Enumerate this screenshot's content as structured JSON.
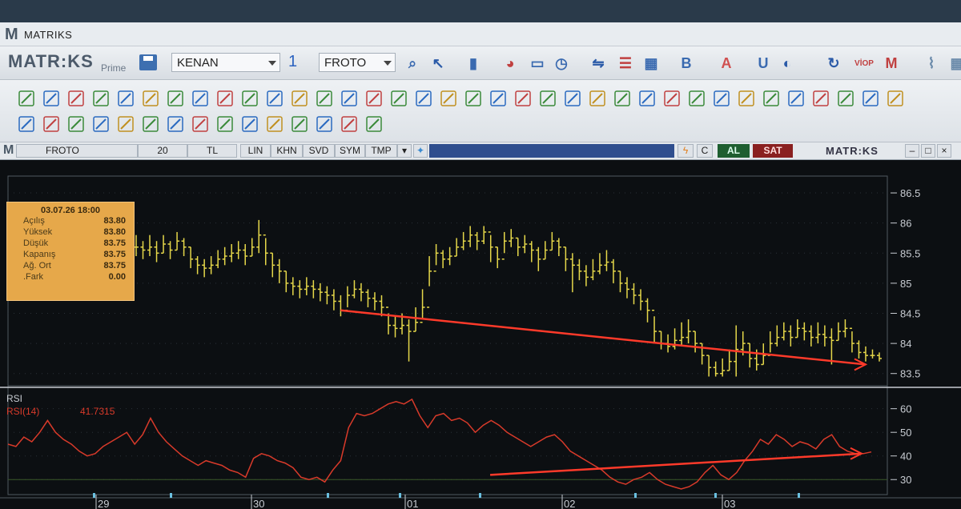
{
  "window": {
    "title": "MATRIKS"
  },
  "toolbar": {
    "brand": "MATR:KS",
    "brand_sub": "Prime",
    "user_select": "KENAN",
    "layout_select": "1",
    "symbol_select": "FROTO"
  },
  "chart_header": {
    "symbol": "FROTO",
    "period": "20",
    "currency": "TL",
    "buttons": [
      "LIN",
      "KHN",
      "SVD",
      "SYM",
      "TMP"
    ],
    "buy_label": "AL",
    "sell_label": "SAT",
    "brand": "MATR:KS"
  },
  "info_box": {
    "date": "03.07.26 18:00",
    "rows": [
      {
        "label": "Açılış",
        "value": "83.80"
      },
      {
        "label": "Yüksek",
        "value": "83.80"
      },
      {
        "label": "Düşük",
        "value": "83.75"
      },
      {
        "label": "Kapanış",
        "value": "83.75"
      },
      {
        "label": "Ağ. Ort",
        "value": "83.75"
      },
      {
        "label": ".Fark",
        "value": "0.00"
      }
    ]
  },
  "colors": {
    "price": "#e6d84a",
    "rsi": "#d83a2a",
    "trendline": "#ff3a2a",
    "grid": "#2a3038",
    "axis_text": "#c8ccd2"
  },
  "chart_data": [
    {
      "type": "ohlc",
      "y_ticks": [
        86.5,
        86,
        85.5,
        85,
        84.5,
        84,
        83.5
      ],
      "ylim": [
        83.35,
        86.7
      ],
      "x_labels": [
        "29",
        "30",
        "01",
        "02",
        "03"
      ],
      "close": [
        85.6,
        85.55,
        85.6,
        85.5,
        85.65,
        85.55,
        85.7,
        85.6,
        85.4,
        85.3,
        85.25,
        85.3,
        85.4,
        85.45,
        85.5,
        85.55,
        85.45,
        85.6,
        85.8,
        85.5,
        85.3,
        85.2,
        85.0,
        84.95,
        84.9,
        84.95,
        84.9,
        84.85,
        84.8,
        84.7,
        84.55,
        84.8,
        84.9,
        84.85,
        84.75,
        84.7,
        84.6,
        84.3,
        84.25,
        84.3,
        84.2,
        84.35,
        84.6,
        85.2,
        85.5,
        85.4,
        85.45,
        85.6,
        85.7,
        85.8,
        85.7,
        85.85,
        85.6,
        85.4,
        85.7,
        85.75,
        85.6,
        85.65,
        85.55,
        85.4,
        85.55,
        85.7,
        85.6,
        85.4,
        85.3,
        85.2,
        85.1,
        85.2,
        85.3,
        85.35,
        85.2,
        85.0,
        84.9,
        84.8,
        84.7,
        84.55,
        84.2,
        84.0,
        83.95,
        84.05,
        84.1,
        84.2,
        84.0,
        83.8,
        83.6,
        83.5,
        83.55,
        83.7,
        83.9,
        84.0,
        83.75,
        83.65,
        83.8,
        84.0,
        84.1,
        84.2,
        84.1,
        84.25,
        84.2,
        84.1,
        84.15,
        84.1,
        84.05,
        84.2,
        84.25,
        84.0,
        83.85,
        83.8,
        83.8,
        83.75
      ],
      "high": [
        85.8,
        85.7,
        85.8,
        85.7,
        85.8,
        85.7,
        85.85,
        85.75,
        85.6,
        85.45,
        85.4,
        85.45,
        85.55,
        85.6,
        85.65,
        85.7,
        85.65,
        85.75,
        86.05,
        85.75,
        85.5,
        85.4,
        85.2,
        85.1,
        85.05,
        85.1,
        85.05,
        85.0,
        84.95,
        84.9,
        84.8,
        84.95,
        85.05,
        85.0,
        84.9,
        84.85,
        84.8,
        84.5,
        84.45,
        84.5,
        84.4,
        84.6,
        84.9,
        85.45,
        85.65,
        85.55,
        85.6,
        85.75,
        85.85,
        85.95,
        85.85,
        85.95,
        85.8,
        85.6,
        85.85,
        85.9,
        85.75,
        85.8,
        85.7,
        85.6,
        85.7,
        85.85,
        85.75,
        85.6,
        85.5,
        85.4,
        85.3,
        85.4,
        85.5,
        85.55,
        85.4,
        85.2,
        85.1,
        85.0,
        84.9,
        84.75,
        84.45,
        84.2,
        84.15,
        84.25,
        84.35,
        84.4,
        84.2,
        84.0,
        83.8,
        83.7,
        83.75,
        83.9,
        84.3,
        84.2,
        84.0,
        83.9,
        84.0,
        84.2,
        84.3,
        84.35,
        84.3,
        84.4,
        84.35,
        84.3,
        84.35,
        84.3,
        84.25,
        84.35,
        84.4,
        84.2,
        84.05,
        83.95,
        83.9,
        83.85
      ],
      "low": [
        85.45,
        85.4,
        85.45,
        85.35,
        85.5,
        85.4,
        85.55,
        85.45,
        85.25,
        85.15,
        85.1,
        85.15,
        85.25,
        85.3,
        85.35,
        85.4,
        85.3,
        85.45,
        85.5,
        85.3,
        85.1,
        85.0,
        84.85,
        84.8,
        84.75,
        84.8,
        84.75,
        84.7,
        84.65,
        84.55,
        84.45,
        84.6,
        84.75,
        84.7,
        84.6,
        84.55,
        84.45,
        84.15,
        84.1,
        84.15,
        83.7,
        84.2,
        84.4,
        84.95,
        85.3,
        85.25,
        85.3,
        85.45,
        85.55,
        85.6,
        85.55,
        85.65,
        85.35,
        85.25,
        85.5,
        85.6,
        85.45,
        85.5,
        85.35,
        85.2,
        85.4,
        85.55,
        85.45,
        85.2,
        84.85,
        85.05,
        84.95,
        85.05,
        85.15,
        85.2,
        85.0,
        84.85,
        84.75,
        84.65,
        84.55,
        84.35,
        84.0,
        83.9,
        83.85,
        83.9,
        83.95,
        84.0,
        83.85,
        83.65,
        83.45,
        83.45,
        83.45,
        83.55,
        83.45,
        83.8,
        83.6,
        83.55,
        83.65,
        83.85,
        83.95,
        84.05,
        83.95,
        84.1,
        84.05,
        83.95,
        84.0,
        83.95,
        83.65,
        84.05,
        84.1,
        83.85,
        83.75,
        83.7,
        83.75,
        83.7
      ],
      "trendline": {
        "from": [
          30,
          84.55
        ],
        "to": [
          107,
          83.65
        ]
      }
    },
    {
      "type": "line",
      "title": "RSI",
      "series": [
        {
          "name": "RSI(14)",
          "last_value": "41.7315"
        }
      ],
      "y_ticks": [
        60,
        50,
        40,
        30
      ],
      "ylim": [
        25,
        67
      ],
      "values": [
        45,
        44,
        48,
        46,
        50,
        55,
        50,
        47,
        45,
        42,
        40,
        41,
        44,
        46,
        48,
        50,
        45,
        49,
        56,
        50,
        46,
        43,
        40,
        38,
        36,
        38,
        37,
        36,
        34,
        33,
        31,
        39,
        41,
        40,
        38,
        37,
        35,
        31,
        30,
        31,
        29,
        34,
        38,
        52,
        58,
        57,
        58,
        60,
        62,
        63,
        62,
        64,
        57,
        52,
        57,
        58,
        55,
        56,
        54,
        50,
        53,
        55,
        53,
        50,
        48,
        46,
        44,
        46,
        48,
        49,
        46,
        42,
        40,
        38,
        36,
        34,
        31,
        29,
        28,
        30,
        31,
        33,
        30,
        28,
        27,
        26,
        27,
        29,
        33,
        36,
        32,
        30,
        33,
        38,
        42,
        47,
        45,
        49,
        47,
        44,
        46,
        45,
        43,
        47,
        49,
        44,
        42,
        41,
        41,
        41.7
      ],
      "trendline": {
        "from": [
          28,
          32
        ],
        "to": [
          107,
          41
        ]
      },
      "hline": 30
    }
  ]
}
